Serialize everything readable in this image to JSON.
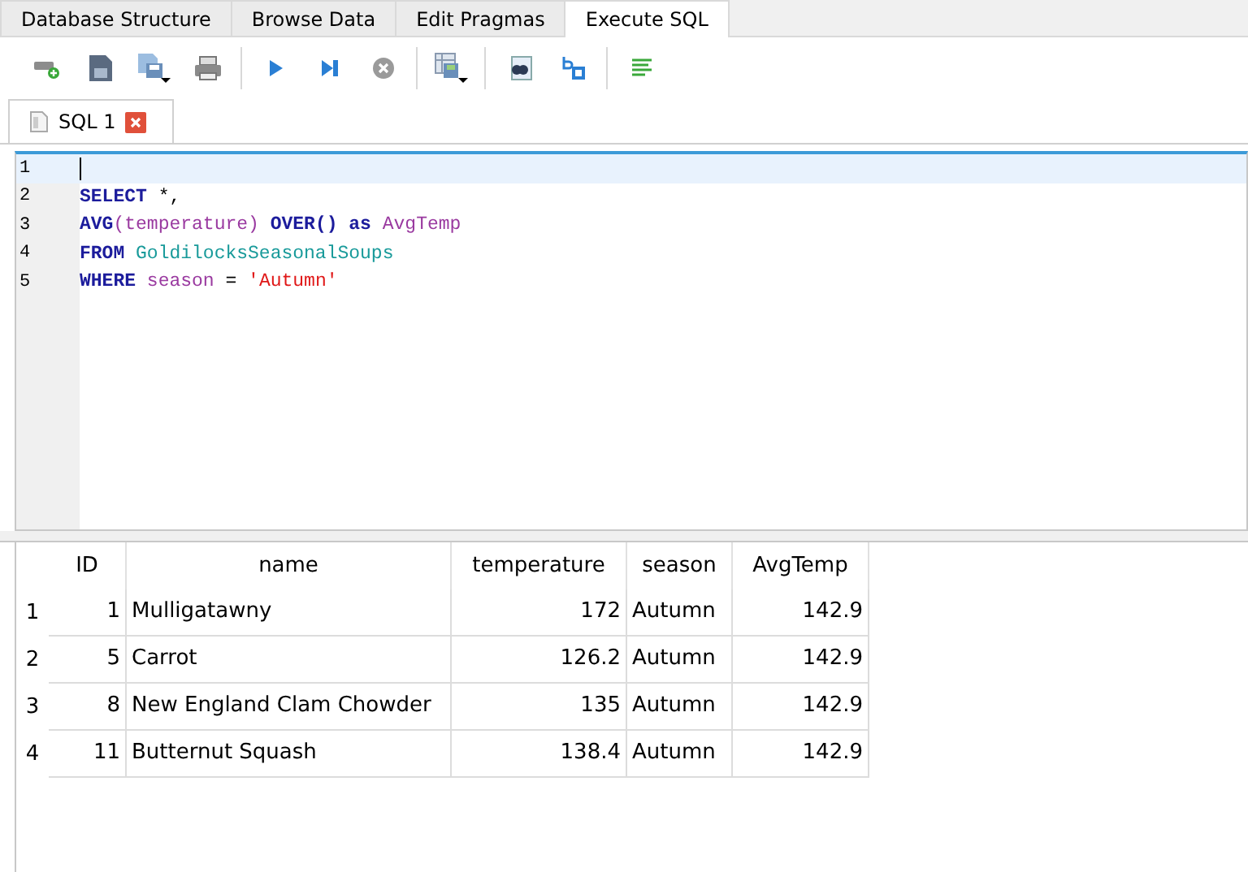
{
  "tabs": [
    {
      "label": "Database Structure",
      "selected": false
    },
    {
      "label": "Browse Data",
      "selected": false
    },
    {
      "label": "Edit Pragmas",
      "selected": false
    },
    {
      "label": "Execute SQL",
      "selected": true
    }
  ],
  "editor_tabs": [
    {
      "label": "SQL 1"
    }
  ],
  "editor": {
    "lines": [
      {
        "number": "1",
        "current": true
      },
      {
        "number": "2",
        "current": false,
        "tokens": [
          {
            "kind": "keyword",
            "text": "SELECT"
          },
          {
            "kind": "plain",
            "text": " *,"
          }
        ]
      },
      {
        "number": "3",
        "current": false,
        "tokens": [
          {
            "kind": "keyword",
            "text": "AVG"
          },
          {
            "kind": "identifier",
            "text": "(temperature)"
          },
          {
            "kind": "keyword",
            "text": " OVER()"
          },
          {
            "kind": "keyword",
            "text": " as"
          },
          {
            "kind": "identifier",
            "text": " AvgTemp"
          }
        ]
      },
      {
        "number": "4",
        "current": false,
        "tokens": [
          {
            "kind": "keyword",
            "text": "FROM"
          },
          {
            "kind": "table",
            "text": " GoldilocksSeasonalSoups"
          }
        ]
      },
      {
        "number": "5",
        "current": false,
        "tokens": [
          {
            "kind": "keyword",
            "text": "WHERE"
          },
          {
            "kind": "identifier",
            "text": " season"
          },
          {
            "kind": "plain",
            "text": " = "
          },
          {
            "kind": "string",
            "text": "'Autumn'"
          }
        ]
      }
    ]
  },
  "results": {
    "columns": [
      "ID",
      "name",
      "temperature",
      "season",
      "AvgTemp"
    ],
    "rows": [
      {
        "number": "1",
        "cells": [
          "1",
          "Mulligatawny",
          "172",
          "Autumn",
          "142.9"
        ]
      },
      {
        "number": "2",
        "cells": [
          "5",
          "Carrot",
          "126.2",
          "Autumn",
          "142.9"
        ]
      },
      {
        "number": "3",
        "cells": [
          "8",
          "New England Clam Chowder",
          "135",
          "Autumn",
          "142.9"
        ]
      },
      {
        "number": "4",
        "cells": [
          "11",
          "Butternut Squash",
          "138.4",
          "Autumn",
          "142.9"
        ]
      }
    ]
  }
}
